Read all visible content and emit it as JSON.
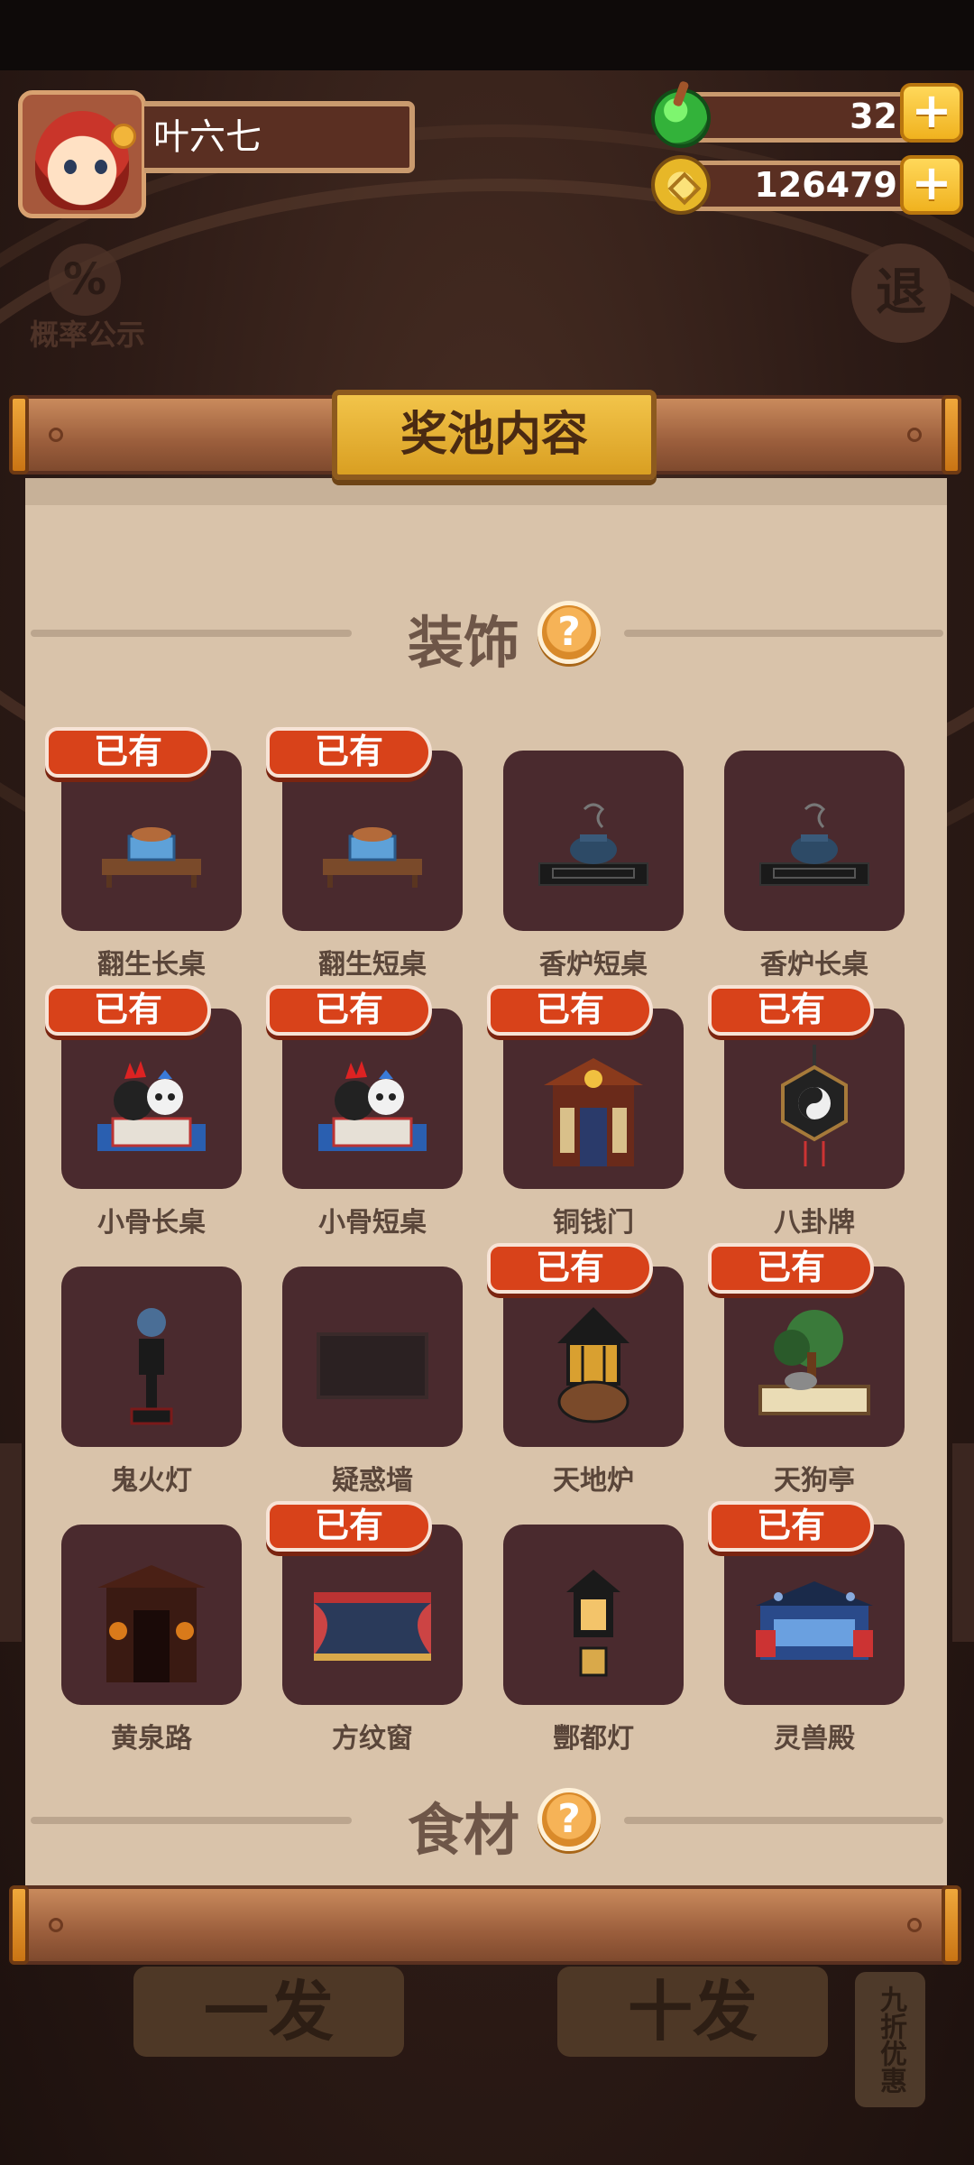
{
  "player": {
    "name": "叶六七"
  },
  "resources": {
    "jade": "32",
    "coins": "126479",
    "plus": "+"
  },
  "background": {
    "prob_icon": "%",
    "prob_label": "概率公示",
    "exit_label": "退",
    "draw_one": "一发",
    "draw_ten": "十发",
    "discount": "九折优惠"
  },
  "panel": {
    "title": "奖池内容",
    "sections": [
      {
        "title": "装饰",
        "help": "?"
      },
      {
        "title": "食材",
        "help": "?"
      }
    ],
    "owned_label": "已有",
    "items": [
      {
        "name": "翻生长桌",
        "owned": true,
        "icon": "altar-table-icon"
      },
      {
        "name": "翻生短桌",
        "owned": true,
        "icon": "altar-table-icon"
      },
      {
        "name": "香炉短桌",
        "owned": false,
        "icon": "incense-table-icon"
      },
      {
        "name": "香炉长桌",
        "owned": false,
        "icon": "incense-table-icon"
      },
      {
        "name": "小骨长桌",
        "owned": true,
        "icon": "skull-table-icon"
      },
      {
        "name": "小骨短桌",
        "owned": true,
        "icon": "skull-table-icon"
      },
      {
        "name": "铜钱门",
        "owned": true,
        "icon": "coin-gate-icon"
      },
      {
        "name": "八卦牌",
        "owned": true,
        "icon": "bagua-plaque-icon"
      },
      {
        "name": "鬼火灯",
        "owned": false,
        "icon": "ghost-lamp-icon"
      },
      {
        "name": "疑惑墙",
        "owned": false,
        "icon": "mystery-wall-icon"
      },
      {
        "name": "天地炉",
        "owned": true,
        "icon": "heaven-furnace-icon"
      },
      {
        "name": "天狗亭",
        "owned": true,
        "icon": "bonsai-pavilion-icon"
      },
      {
        "name": "黄泉路",
        "owned": false,
        "icon": "underworld-gate-icon"
      },
      {
        "name": "方纹窗",
        "owned": true,
        "icon": "pattern-window-icon"
      },
      {
        "name": "酆都灯",
        "owned": false,
        "icon": "fengdu-lantern-icon"
      },
      {
        "name": "灵兽殿",
        "owned": true,
        "icon": "beast-palace-icon"
      }
    ]
  }
}
